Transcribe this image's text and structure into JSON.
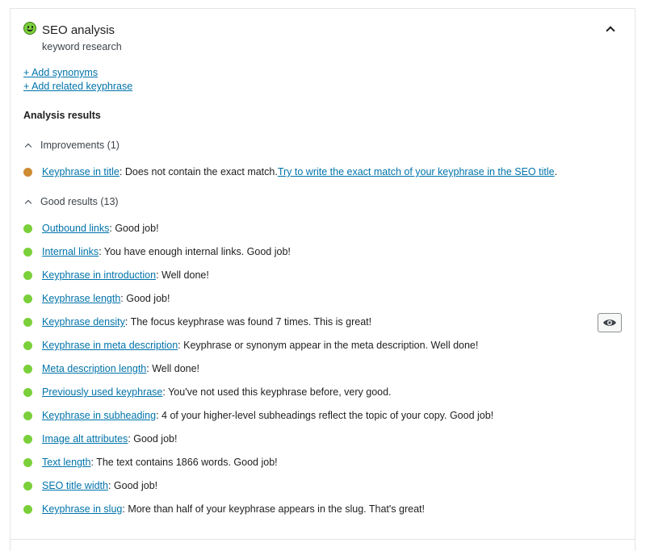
{
  "header": {
    "title": "SEO analysis",
    "subtitle": "keyword research"
  },
  "links": {
    "add_synonyms": "+ Add synonyms",
    "add_related": "+ Add related keyphrase"
  },
  "analysis": {
    "heading": "Analysis results",
    "improvements": {
      "label": "Improvements (1)",
      "items": [
        {
          "link": "Keyphrase in title",
          "text": ": Does not contain the exact match. ",
          "extra_link": "Try to write the exact match of your keyphrase in the SEO title",
          "extra_text": "."
        }
      ]
    },
    "good": {
      "label": "Good results (13)",
      "items": [
        {
          "link": "Outbound links",
          "text": ": Good job!"
        },
        {
          "link": "Internal links",
          "text": ": You have enough internal links. Good job!"
        },
        {
          "link": "Keyphrase in introduction",
          "text": ": Well done!"
        },
        {
          "link": "Keyphrase length",
          "text": ": Good job!"
        },
        {
          "link": "Keyphrase density",
          "text": ": The focus keyphrase was found 7 times. This is great!"
        },
        {
          "link": "Keyphrase in meta description",
          "text": ": Keyphrase or synonym appear in the meta description. Well done!"
        },
        {
          "link": "Meta description length",
          "text": ": Well done!"
        },
        {
          "link": "Previously used keyphrase",
          "text": ": You've not used this keyphrase before, very good."
        },
        {
          "link": "Keyphrase in subheading",
          "text": ": 4 of your higher-level subheadings reflect the topic of your copy. Good job!"
        },
        {
          "link": "Image alt attributes",
          "text": ": Good job!"
        },
        {
          "link": "Text length",
          "text": ": The text contains 1866 words. Good job!"
        },
        {
          "link": "SEO title width",
          "text": ": Good job!"
        },
        {
          "link": "Keyphrase in slug",
          "text": ": More than half of your keyphrase appears in the slug. That's great!"
        }
      ]
    }
  },
  "colors": {
    "link": "#0073aa",
    "good": "#7ad03a",
    "improvement": "#ce8c34"
  },
  "icons": {
    "status": "smiley-icon",
    "collapse": "chevron-up-icon",
    "highlight": "eye-icon"
  }
}
